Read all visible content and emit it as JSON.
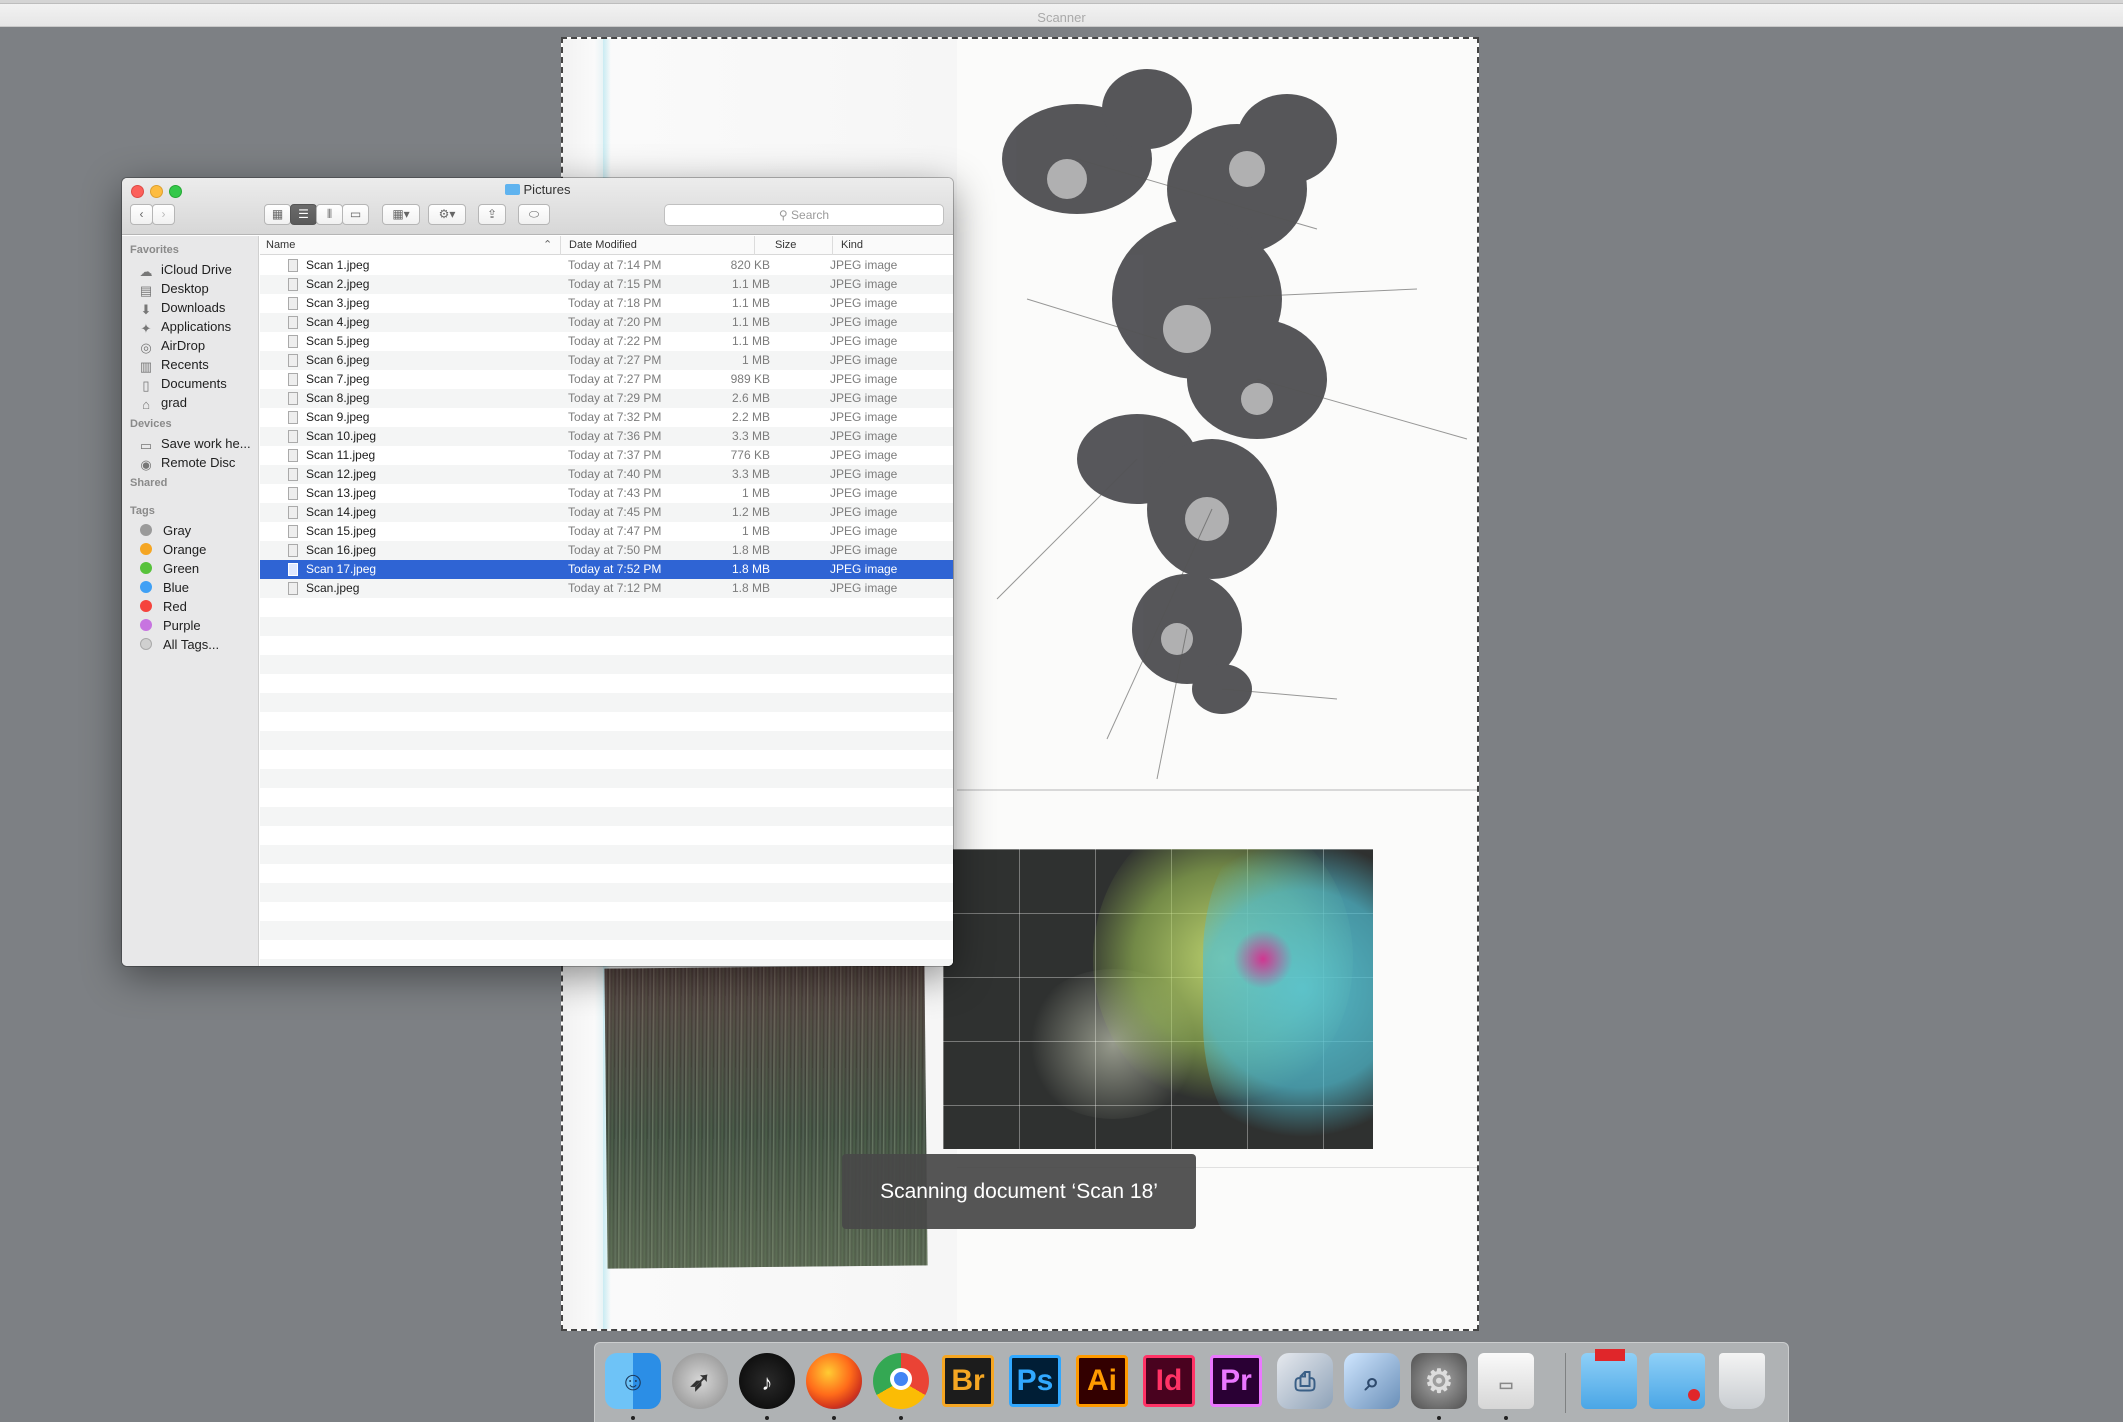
{
  "scanner": {
    "window_title": "Scanner",
    "status_message": "Scanning document ‘Scan 18’"
  },
  "finder": {
    "title": "Pictures",
    "search_placeholder": "Search",
    "sidebar": {
      "favorites_header": "Favorites",
      "favorites": [
        "iCloud Drive",
        "Desktop",
        "Downloads",
        "Applications",
        "AirDrop",
        "Recents",
        "Documents",
        "grad"
      ],
      "devices_header": "Devices",
      "devices": [
        "Save work he...",
        "Remote Disc"
      ],
      "shared_header": "Shared",
      "tags_header": "Tags",
      "tags": [
        {
          "label": "Gray",
          "color": "#9a9a9a"
        },
        {
          "label": "Orange",
          "color": "#f5a623"
        },
        {
          "label": "Green",
          "color": "#57c23b"
        },
        {
          "label": "Blue",
          "color": "#3fa0f5"
        },
        {
          "label": "Red",
          "color": "#f5443d"
        },
        {
          "label": "Purple",
          "color": "#c774e0"
        },
        {
          "label": "All Tags...",
          "color": "#d0d0d0"
        }
      ]
    },
    "columns": {
      "name": "Name",
      "date": "Date Modified",
      "size": "Size",
      "kind": "Kind"
    },
    "files": [
      {
        "name": "Scan 1.jpeg",
        "date": "Today at 7:14 PM",
        "size": "820 KB",
        "kind": "JPEG image"
      },
      {
        "name": "Scan 2.jpeg",
        "date": "Today at 7:15 PM",
        "size": "1.1 MB",
        "kind": "JPEG image"
      },
      {
        "name": "Scan 3.jpeg",
        "date": "Today at 7:18 PM",
        "size": "1.1 MB",
        "kind": "JPEG image"
      },
      {
        "name": "Scan 4.jpeg",
        "date": "Today at 7:20 PM",
        "size": "1.1 MB",
        "kind": "JPEG image"
      },
      {
        "name": "Scan 5.jpeg",
        "date": "Today at 7:22 PM",
        "size": "1.1 MB",
        "kind": "JPEG image"
      },
      {
        "name": "Scan 6.jpeg",
        "date": "Today at 7:27 PM",
        "size": "1 MB",
        "kind": "JPEG image"
      },
      {
        "name": "Scan 7.jpeg",
        "date": "Today at 7:27 PM",
        "size": "989 KB",
        "kind": "JPEG image"
      },
      {
        "name": "Scan 8.jpeg",
        "date": "Today at 7:29 PM",
        "size": "2.6 MB",
        "kind": "JPEG image"
      },
      {
        "name": "Scan 9.jpeg",
        "date": "Today at 7:32 PM",
        "size": "2.2 MB",
        "kind": "JPEG image"
      },
      {
        "name": "Scan 10.jpeg",
        "date": "Today at 7:36 PM",
        "size": "3.3 MB",
        "kind": "JPEG image"
      },
      {
        "name": "Scan 11.jpeg",
        "date": "Today at 7:37 PM",
        "size": "776 KB",
        "kind": "JPEG image"
      },
      {
        "name": "Scan 12.jpeg",
        "date": "Today at 7:40 PM",
        "size": "3.3 MB",
        "kind": "JPEG image"
      },
      {
        "name": "Scan 13.jpeg",
        "date": "Today at 7:43 PM",
        "size": "1 MB",
        "kind": "JPEG image"
      },
      {
        "name": "Scan 14.jpeg",
        "date": "Today at 7:45 PM",
        "size": "1.2 MB",
        "kind": "JPEG image"
      },
      {
        "name": "Scan 15.jpeg",
        "date": "Today at 7:47 PM",
        "size": "1 MB",
        "kind": "JPEG image"
      },
      {
        "name": "Scan 16.jpeg",
        "date": "Today at 7:50 PM",
        "size": "1.8 MB",
        "kind": "JPEG image"
      },
      {
        "name": "Scan 17.jpeg",
        "date": "Today at 7:52 PM",
        "size": "1.8 MB",
        "kind": "JPEG image",
        "selected": true
      },
      {
        "name": "Scan.jpeg",
        "date": "Today at 7:12 PM",
        "size": "1.8 MB",
        "kind": "JPEG image"
      }
    ]
  },
  "dock": {
    "apps": [
      {
        "name": "finder",
        "label": "",
        "running": true
      },
      {
        "name": "launchpad",
        "label": "",
        "running": false
      },
      {
        "name": "dashboard",
        "label": "",
        "running": true
      },
      {
        "name": "firefox",
        "label": "",
        "running": true
      },
      {
        "name": "chrome",
        "label": "",
        "running": true
      },
      {
        "name": "bridge",
        "label": "Br",
        "color": "#f5a623",
        "running": false
      },
      {
        "name": "photoshop",
        "label": "Ps",
        "color": "#31a8ff",
        "running": false
      },
      {
        "name": "illustrator",
        "label": "Ai",
        "color": "#ff9a00",
        "running": false
      },
      {
        "name": "indesign",
        "label": "Id",
        "color": "#ff3366",
        "running": false
      },
      {
        "name": "premiere",
        "label": "Pr",
        "color": "#ea77ff",
        "running": false
      },
      {
        "name": "image-capture",
        "label": "",
        "running": false
      },
      {
        "name": "preview",
        "label": "",
        "running": false
      },
      {
        "name": "system-preferences",
        "label": "",
        "running": true
      },
      {
        "name": "scanner-drive",
        "label": "",
        "running": true
      }
    ]
  }
}
